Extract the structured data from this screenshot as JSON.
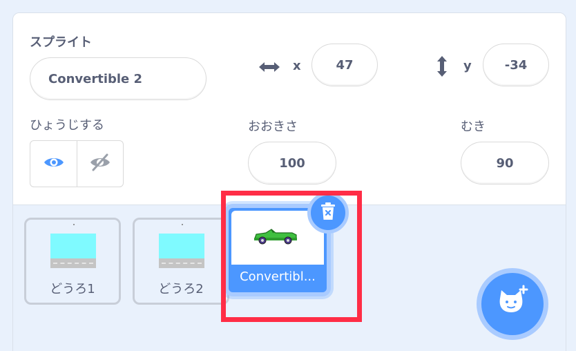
{
  "sprite_info": {
    "sprite_label": "スプライト",
    "sprite_name": "Convertible 2",
    "x_label": "x",
    "x_value": "47",
    "y_label": "y",
    "y_value": "-34",
    "show_label": "ひょうじする",
    "size_label": "おおきさ",
    "size_value": "100",
    "direction_label": "むき",
    "direction_value": "90"
  },
  "sprites": [
    {
      "name": "どうろ1",
      "selected": false
    },
    {
      "name": "どうろ2",
      "selected": false
    },
    {
      "name": "Convertibl...",
      "selected": true
    }
  ],
  "icons": {
    "x_axis": "horizontal-arrows-icon",
    "y_axis": "vertical-arrows-icon",
    "show": "eye-icon",
    "hide": "eye-slash-icon",
    "delete": "trash-icon",
    "add_sprite": "cat-plus-icon"
  },
  "colors": {
    "accent": "#4c97ff",
    "highlight": "#ff2d46",
    "background": "#e9f1fc"
  }
}
